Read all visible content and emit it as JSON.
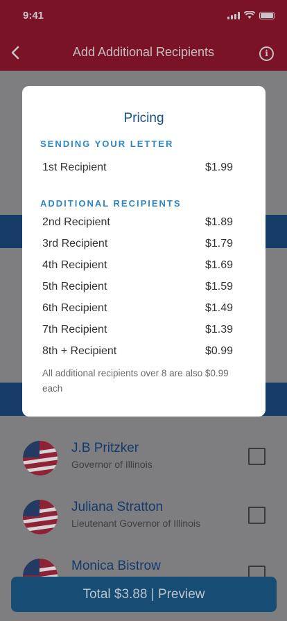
{
  "status_bar": {
    "time": "9:41"
  },
  "header": {
    "title": "Add Additional Recipients"
  },
  "modal": {
    "title": "Pricing",
    "section_sending": "SENDING YOUR LETTER",
    "first": {
      "label": "1st Recipient",
      "price": "$1.99"
    },
    "section_additional": "ADDITIONAL RECIPIENTS",
    "additional": [
      {
        "label": "2nd Recipient",
        "price": "$1.89"
      },
      {
        "label": "3rd Recipient",
        "price": "$1.79"
      },
      {
        "label": "4th Recipient",
        "price": "$1.69"
      },
      {
        "label": "5th Recipient",
        "price": "$1.59"
      },
      {
        "label": "6th Recipient",
        "price": "$1.49"
      },
      {
        "label": "7th Recipient",
        "price": "$1.39"
      },
      {
        "label": "8th + Recipient",
        "price": "$0.99"
      }
    ],
    "footnote": "All additional recipients over 8 are also $0.99 each"
  },
  "recipients": [
    {
      "name": "J.B Pritzker",
      "role": "Governor of Illinois",
      "checked": false
    },
    {
      "name": "Juliana Stratton",
      "role": "Lieutenant Governor of Illinois",
      "checked": false
    },
    {
      "name": "Monica Bistrow",
      "role": "",
      "checked": false
    }
  ],
  "footer": {
    "button_label": "Total $3.88  |  Preview"
  },
  "colors": {
    "header": "#7a1326",
    "band": "#163c69",
    "accent": "#2c86c6",
    "title": "#1a4f86"
  }
}
